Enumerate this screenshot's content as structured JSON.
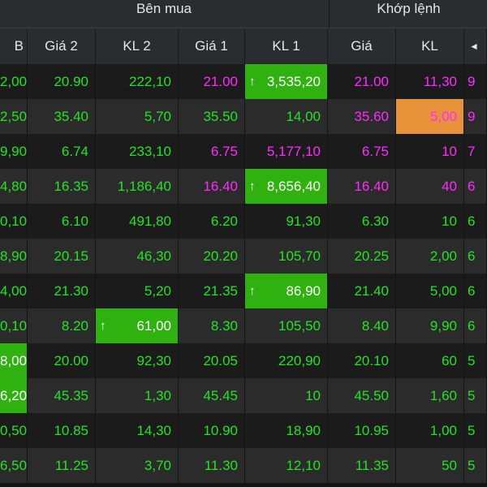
{
  "groups": {
    "buy": "Bên mua",
    "match": "Khớp lệnh"
  },
  "headers": [
    "B",
    "Giá 2",
    "KL 2",
    "Giá 1",
    "KL 1",
    "Giá",
    "KL",
    "◄"
  ],
  "rows": [
    [
      {
        "v": "2,00",
        "c": "green"
      },
      {
        "v": "20.90",
        "c": "green"
      },
      {
        "v": "222,10",
        "c": "green"
      },
      {
        "v": "21.00",
        "c": "magenta"
      },
      {
        "v": "3,535,20",
        "c": "white",
        "hl": "green",
        "up": true
      },
      {
        "v": "21.00",
        "c": "magenta"
      },
      {
        "v": "11,30",
        "c": "magenta"
      },
      {
        "v": "9",
        "c": "magenta"
      }
    ],
    [
      {
        "v": "2,50",
        "c": "green"
      },
      {
        "v": "35.40",
        "c": "green"
      },
      {
        "v": "5,70",
        "c": "green"
      },
      {
        "v": "35.50",
        "c": "green"
      },
      {
        "v": "14,00",
        "c": "green"
      },
      {
        "v": "35.60",
        "c": "magenta"
      },
      {
        "v": "5,00",
        "c": "magenta",
        "hl": "orange"
      },
      {
        "v": "9",
        "c": "magenta"
      }
    ],
    [
      {
        "v": "9,90",
        "c": "green"
      },
      {
        "v": "6.74",
        "c": "green"
      },
      {
        "v": "233,10",
        "c": "green"
      },
      {
        "v": "6.75",
        "c": "magenta"
      },
      {
        "v": "5,177,10",
        "c": "magenta"
      },
      {
        "v": "6.75",
        "c": "magenta"
      },
      {
        "v": "10",
        "c": "magenta"
      },
      {
        "v": "7",
        "c": "magenta"
      }
    ],
    [
      {
        "v": "4,80",
        "c": "green"
      },
      {
        "v": "16.35",
        "c": "green"
      },
      {
        "v": "1,186,40",
        "c": "green"
      },
      {
        "v": "16.40",
        "c": "magenta"
      },
      {
        "v": "8,656,40",
        "c": "white",
        "hl": "green",
        "up": true
      },
      {
        "v": "16.40",
        "c": "magenta"
      },
      {
        "v": "40",
        "c": "magenta"
      },
      {
        "v": "6",
        "c": "magenta"
      }
    ],
    [
      {
        "v": "0,10",
        "c": "green"
      },
      {
        "v": "6.10",
        "c": "green"
      },
      {
        "v": "491,80",
        "c": "green"
      },
      {
        "v": "6.20",
        "c": "green"
      },
      {
        "v": "91,30",
        "c": "green"
      },
      {
        "v": "6.30",
        "c": "green"
      },
      {
        "v": "10",
        "c": "green"
      },
      {
        "v": "6",
        "c": "green"
      }
    ],
    [
      {
        "v": "8,90",
        "c": "green"
      },
      {
        "v": "20.15",
        "c": "green"
      },
      {
        "v": "46,30",
        "c": "green"
      },
      {
        "v": "20.20",
        "c": "green"
      },
      {
        "v": "105,70",
        "c": "green"
      },
      {
        "v": "20.25",
        "c": "green"
      },
      {
        "v": "2,00",
        "c": "green"
      },
      {
        "v": "6",
        "c": "green"
      }
    ],
    [
      {
        "v": "4,00",
        "c": "green"
      },
      {
        "v": "21.30",
        "c": "green"
      },
      {
        "v": "5,20",
        "c": "green"
      },
      {
        "v": "21.35",
        "c": "green"
      },
      {
        "v": "86,90",
        "c": "white",
        "hl": "green",
        "up": true
      },
      {
        "v": "21.40",
        "c": "green"
      },
      {
        "v": "5,00",
        "c": "green"
      },
      {
        "v": "6",
        "c": "green"
      }
    ],
    [
      {
        "v": "0,10",
        "c": "green"
      },
      {
        "v": "8.20",
        "c": "green"
      },
      {
        "v": "61,00",
        "c": "white",
        "hl": "green",
        "up": true
      },
      {
        "v": "8.30",
        "c": "green"
      },
      {
        "v": "105,50",
        "c": "green"
      },
      {
        "v": "8.40",
        "c": "green"
      },
      {
        "v": "9,90",
        "c": "green"
      },
      {
        "v": "6",
        "c": "green"
      }
    ],
    [
      {
        "v": "8,00",
        "c": "white",
        "hl": "green"
      },
      {
        "v": "20.00",
        "c": "green"
      },
      {
        "v": "92,30",
        "c": "green"
      },
      {
        "v": "20.05",
        "c": "green"
      },
      {
        "v": "220,90",
        "c": "green"
      },
      {
        "v": "20.10",
        "c": "green"
      },
      {
        "v": "60",
        "c": "green"
      },
      {
        "v": "5",
        "c": "green"
      }
    ],
    [
      {
        "v": "6,20",
        "c": "white",
        "hl": "green"
      },
      {
        "v": "45.35",
        "c": "green"
      },
      {
        "v": "1,30",
        "c": "green"
      },
      {
        "v": "45.45",
        "c": "green"
      },
      {
        "v": "10",
        "c": "green"
      },
      {
        "v": "45.50",
        "c": "green"
      },
      {
        "v": "1,60",
        "c": "green"
      },
      {
        "v": "5",
        "c": "green"
      }
    ],
    [
      {
        "v": "0,50",
        "c": "green"
      },
      {
        "v": "10.85",
        "c": "green"
      },
      {
        "v": "14,30",
        "c": "green"
      },
      {
        "v": "10.90",
        "c": "green"
      },
      {
        "v": "18,90",
        "c": "green"
      },
      {
        "v": "10.95",
        "c": "green"
      },
      {
        "v": "1,00",
        "c": "green"
      },
      {
        "v": "5",
        "c": "green"
      }
    ],
    [
      {
        "v": "6,50",
        "c": "green"
      },
      {
        "v": "11.25",
        "c": "green"
      },
      {
        "v": "3,70",
        "c": "green"
      },
      {
        "v": "11.30",
        "c": "green"
      },
      {
        "v": "12,10",
        "c": "green"
      },
      {
        "v": "11.35",
        "c": "green"
      },
      {
        "v": "50",
        "c": "green"
      },
      {
        "v": "5",
        "c": "green"
      }
    ]
  ],
  "colors": {
    "up": "#21e521",
    "ceiling": "#ff2bff",
    "flash_up": "#2fb20f",
    "flash_alt": "#e8923a"
  },
  "icons": {
    "up": "arrow-up-icon",
    "scroll": "scroll-left-icon"
  }
}
